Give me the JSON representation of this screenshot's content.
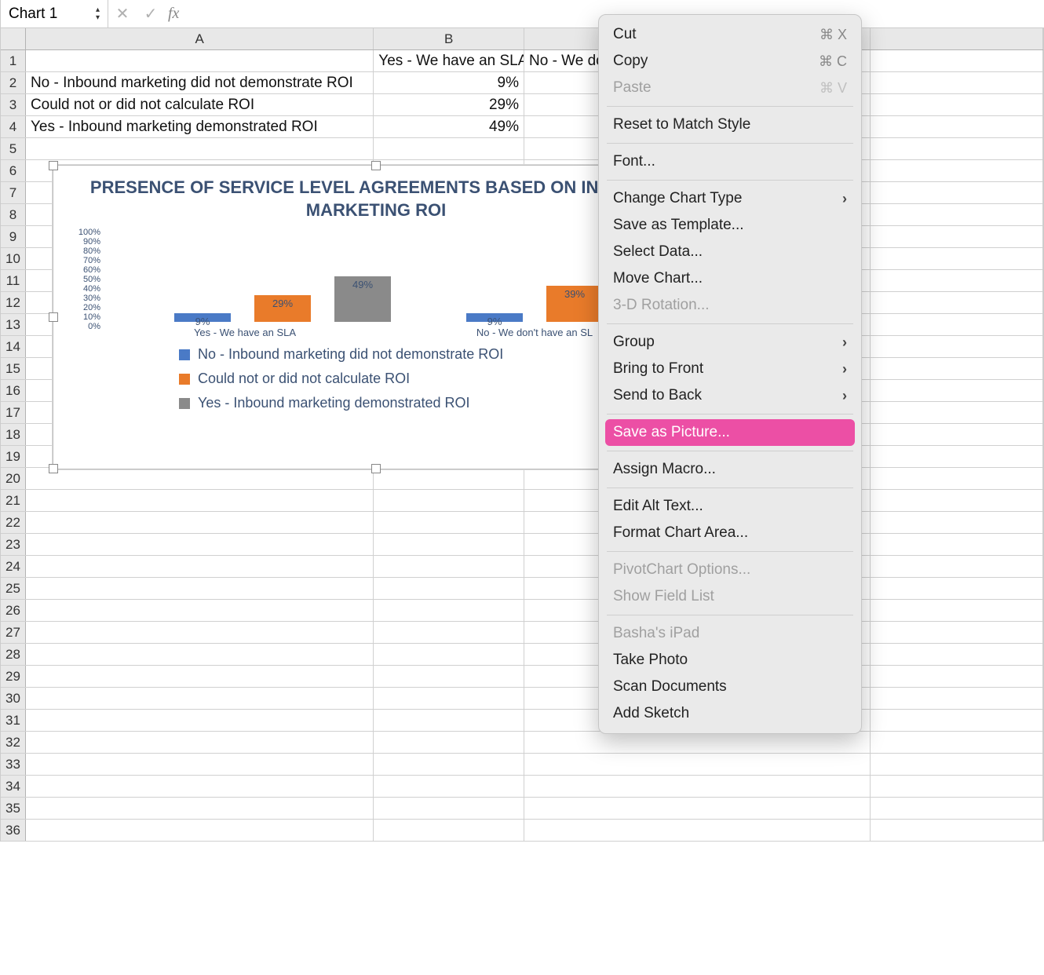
{
  "formula_bar": {
    "name_box": "Chart 1",
    "fx_label": "fx"
  },
  "columns": {
    "A": "A",
    "B": "B"
  },
  "rows": [
    "1",
    "2",
    "3",
    "4",
    "5",
    "6",
    "7",
    "8",
    "9",
    "10",
    "11",
    "12",
    "13",
    "14",
    "15",
    "16",
    "17",
    "18",
    "19",
    "20",
    "21",
    "22",
    "23",
    "24",
    "25",
    "26",
    "27",
    "28",
    "29",
    "30",
    "31",
    "32",
    "33",
    "34",
    "35",
    "36"
  ],
  "cells": {
    "B1": "Yes - We have an SLA",
    "C1": "No - We do",
    "A2": "No - Inbound marketing did not demonstrate ROI",
    "B2": "9%",
    "A3": "Could not or did not calculate ROI",
    "B3": "29%",
    "A4": "Yes - Inbound marketing demonstrated ROI",
    "B4": "49%"
  },
  "chart_data": {
    "type": "bar",
    "title": "PRESENCE OF SERVICE LEVEL AGREEMENTS BASED ON INBOUND MARKETING ROI",
    "ylabel": "",
    "ylim": [
      0,
      100
    ],
    "y_ticks": [
      "100%",
      "90%",
      "80%",
      "70%",
      "60%",
      "50%",
      "40%",
      "30%",
      "20%",
      "10%",
      "0%"
    ],
    "categories": [
      "Yes - We have an SLA",
      "No - We don't have an SL"
    ],
    "series": [
      {
        "name": "No - Inbound marketing did not demonstrate ROI",
        "color": "#4a7ac6",
        "values": [
          9,
          9
        ]
      },
      {
        "name": "Could not or did not calculate ROI",
        "color": "#e97b2a",
        "values": [
          29,
          39
        ]
      },
      {
        "name": "Yes - Inbound marketing demonstrated ROI",
        "color": "#8a8a8a",
        "values": [
          49,
          null
        ]
      }
    ],
    "data_labels": {
      "g1": [
        "9%",
        "29%",
        "49%"
      ],
      "g2": [
        "9%",
        "39%"
      ]
    }
  },
  "context_menu": {
    "cut": "Cut",
    "cut_sc": "⌘ X",
    "copy": "Copy",
    "copy_sc": "⌘ C",
    "paste": "Paste",
    "paste_sc": "⌘ V",
    "reset": "Reset to Match Style",
    "font": "Font...",
    "change_type": "Change Chart Type",
    "save_template": "Save as Template...",
    "select_data": "Select Data...",
    "move_chart": "Move Chart...",
    "rotation": "3-D Rotation...",
    "group": "Group",
    "bring_front": "Bring to Front",
    "send_back": "Send to Back",
    "save_picture": "Save as Picture...",
    "assign_macro": "Assign Macro...",
    "edit_alt": "Edit Alt Text...",
    "format_area": "Format Chart Area...",
    "pivot_opts": "PivotChart Options...",
    "show_field": "Show Field List",
    "ipad": "Basha's iPad",
    "take_photo": "Take Photo",
    "scan_docs": "Scan Documents",
    "add_sketch": "Add Sketch"
  }
}
